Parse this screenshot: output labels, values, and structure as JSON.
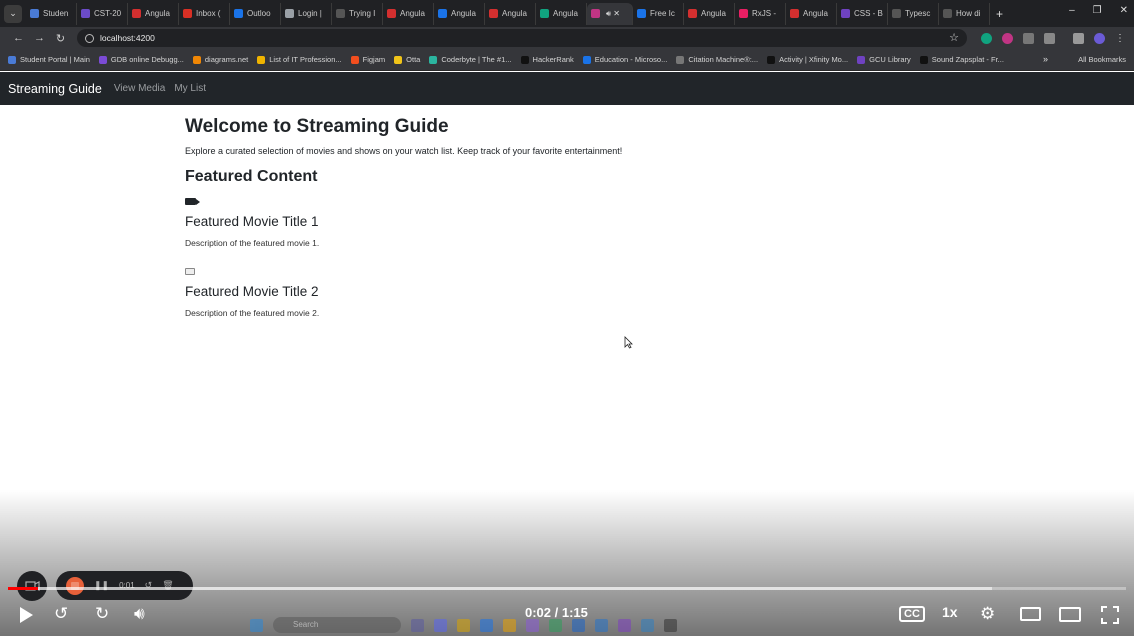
{
  "browser": {
    "tabs": [
      {
        "label": "Studen",
        "color": "#4a7bd6"
      },
      {
        "label": "CST-20",
        "color": "#6b4bc9"
      },
      {
        "label": "Angula",
        "color": "#d32f2f"
      },
      {
        "label": "Inbox (",
        "color": "#d93025"
      },
      {
        "label": "Outloo",
        "color": "#1a73e8"
      },
      {
        "label": "Login |",
        "color": "#9aa0a6"
      },
      {
        "label": "Trying I",
        "color": "#555"
      },
      {
        "label": "Angula",
        "color": "#d32f2f"
      },
      {
        "label": "Angula",
        "color": "#1a73e8"
      },
      {
        "label": "Angula",
        "color": "#d32f2f"
      },
      {
        "label": "Angula",
        "color": "#10a37f"
      },
      {
        "label": "",
        "color": "#c13584",
        "active": true
      },
      {
        "label": "Free Ic",
        "color": "#1a73e8"
      },
      {
        "label": "Angula",
        "color": "#d32f2f"
      },
      {
        "label": "RxJS -",
        "color": "#e91e63"
      },
      {
        "label": "Angula",
        "color": "#d32f2f"
      },
      {
        "label": "CSS - B",
        "color": "#6f42c1"
      },
      {
        "label": "Typesc",
        "color": "#555"
      },
      {
        "label": "How di",
        "color": "#555"
      }
    ],
    "url": "localhost:4200",
    "bookmarks": [
      {
        "label": "Student Portal | Main",
        "color": "#4a7bd6"
      },
      {
        "label": "GDB online Debugg...",
        "color": "#7b4bd6"
      },
      {
        "label": "diagrams.net",
        "color": "#f08705"
      },
      {
        "label": "List of IT Profession...",
        "color": "#f0b400"
      },
      {
        "label": "Figjam",
        "color": "#f24e1e"
      },
      {
        "label": "Otta",
        "color": "#f0c419"
      },
      {
        "label": "Coderbyte | The #1...",
        "color": "#2bb5a0"
      },
      {
        "label": "HackerRank",
        "color": "#111"
      },
      {
        "label": "Education - Microso...",
        "color": "#1a73e8"
      },
      {
        "label": "Citation Machine®:...",
        "color": "#777"
      },
      {
        "label": "Activity | Xfinity Mo...",
        "color": "#111"
      },
      {
        "label": "GCU Library",
        "color": "#6f42c1"
      },
      {
        "label": "Sound Zapsplat - Fr...",
        "color": "#111"
      }
    ],
    "all_bookmarks": "All Bookmarks"
  },
  "app": {
    "brand": "Streaming Guide",
    "nav": [
      "View Media",
      "My List"
    ]
  },
  "main": {
    "heading": "Welcome to Streaming Guide",
    "lead": "Explore a curated selection of movies and shows on your watch list. Keep track of your favorite entertainment!",
    "featured_heading": "Featured Content",
    "featured": [
      {
        "icon": "video-camera-icon",
        "title": "Featured Movie Title 1",
        "description": "Description of the featured movie 1."
      },
      {
        "icon": "tv-icon",
        "title": "Featured Movie Title 2",
        "description": "Description of the featured movie 2."
      }
    ]
  },
  "recorder": {
    "time": "0:01"
  },
  "player": {
    "time": "0:02 / 1:15",
    "speed": "1x",
    "played_fraction": 0.0267,
    "buffered_fraction": 0.88
  },
  "taskbar": {
    "search_placeholder": "Search"
  }
}
